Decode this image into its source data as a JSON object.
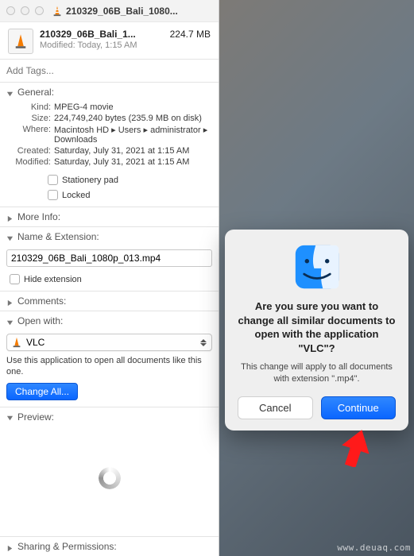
{
  "window": {
    "title": "210329_06B_Bali_1080...",
    "filename": "210329_06B_Bali_1...",
    "filesize": "224.7 MB",
    "modified_line": "Modified: Today, 1:15 AM",
    "tags_placeholder": "Add Tags..."
  },
  "sections": {
    "general": {
      "label": "General:",
      "kind_label": "Kind:",
      "kind_value": "MPEG-4 movie",
      "size_label": "Size:",
      "size_value": "224,749,240 bytes (235.9 MB on disk)",
      "where_label": "Where:",
      "where_value": "Macintosh HD ▸ Users ▸ administrator ▸ Downloads",
      "created_label": "Created:",
      "created_value": "Saturday, July 31, 2021 at 1:15 AM",
      "modified_label": "Modified:",
      "modified_value": "Saturday, July 31, 2021 at 1:15 AM",
      "stationery_label": "Stationery pad",
      "locked_label": "Locked"
    },
    "more_info": {
      "label": "More Info:"
    },
    "name_ext": {
      "label": "Name & Extension:",
      "value": "210329_06B_Bali_1080p_013.mp4",
      "hide_ext_label": "Hide extension"
    },
    "comments": {
      "label": "Comments:"
    },
    "open_with": {
      "label": "Open with:",
      "app": "VLC",
      "desc": "Use this application to open all documents like this one.",
      "change_btn": "Change All..."
    },
    "preview": {
      "label": "Preview:"
    },
    "sharing": {
      "label": "Sharing & Permissions:"
    }
  },
  "dialog": {
    "title": "Are you sure you want to change all similar documents to open with the application \"VLC\"?",
    "message": "This change will apply to all documents with extension \".mp4\".",
    "cancel": "Cancel",
    "continue": "Continue"
  },
  "watermark": "www.deuaq.com"
}
